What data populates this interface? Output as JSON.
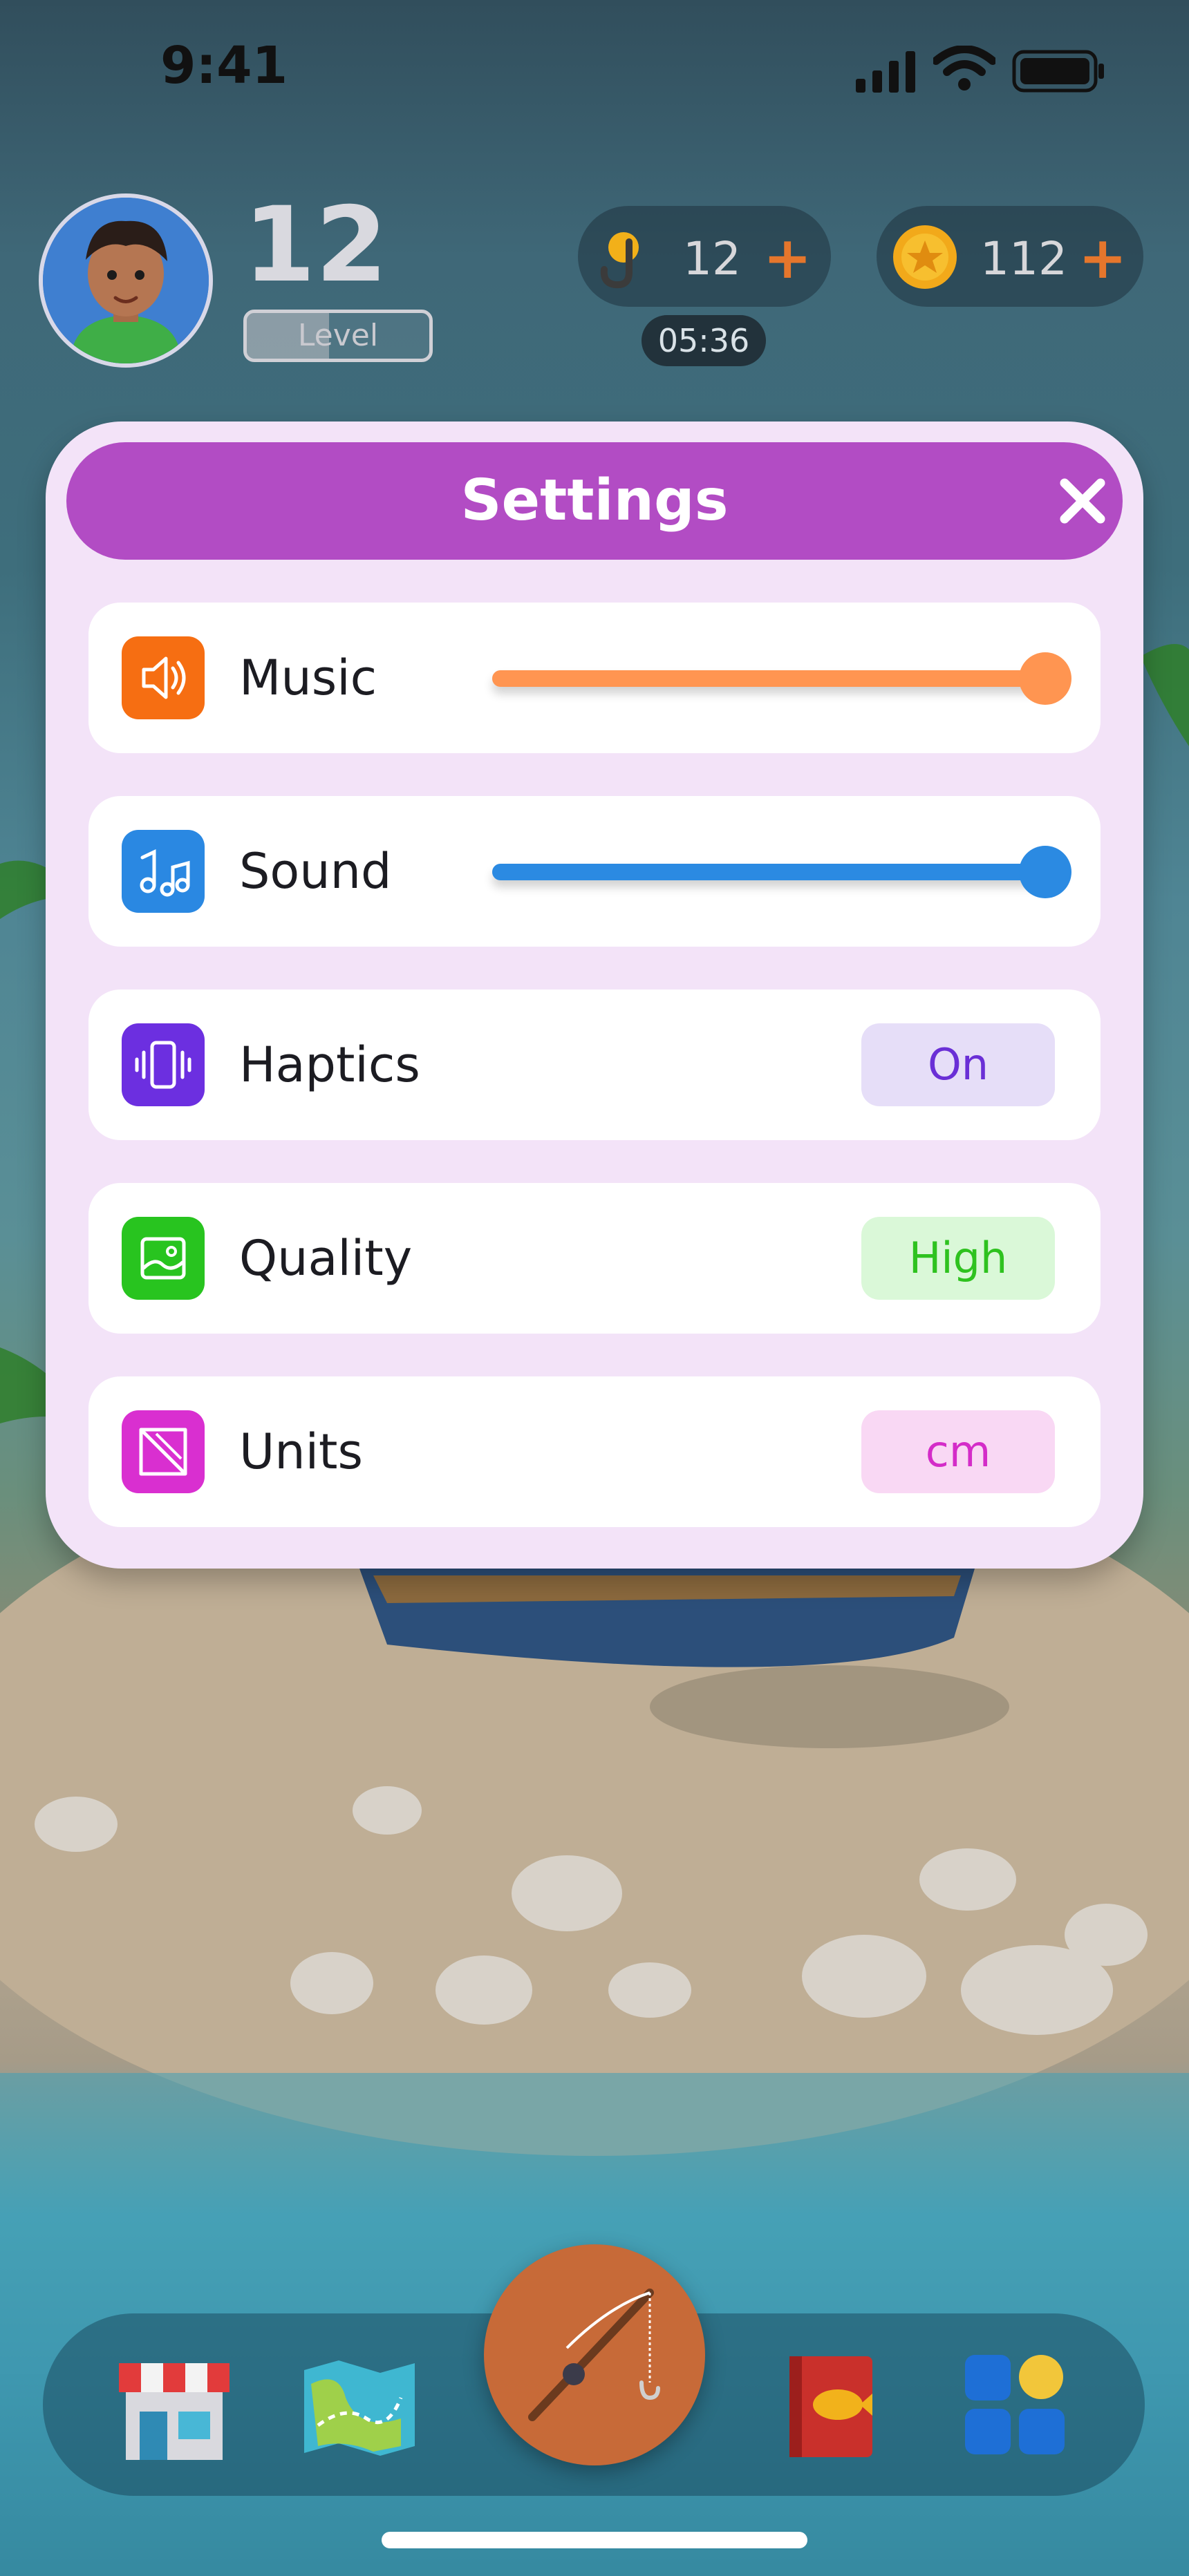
{
  "status_bar": {
    "time": "9:41"
  },
  "player": {
    "level": "12",
    "level_label": "Level",
    "level_progress": 0.45
  },
  "resources": {
    "bait": {
      "count": "12",
      "plus": "+",
      "timer": "05:36"
    },
    "coins": {
      "count": "112",
      "plus": "+"
    }
  },
  "settings": {
    "title": "Settings",
    "rows": [
      {
        "label": "Music",
        "type": "slider",
        "value": 1.0,
        "color": "#ff9551",
        "icon": "speaker-icon",
        "icon_bg": "#f66e12"
      },
      {
        "label": "Sound",
        "type": "slider",
        "value": 1.0,
        "color": "#2b8ae2",
        "icon": "music-notes-icon",
        "icon_bg": "#2a88e2"
      },
      {
        "label": "Haptics",
        "type": "toggle",
        "value": "On",
        "pill_bg": "#e6def8",
        "pill_fg": "#6a2fd6",
        "icon": "vibrate-icon",
        "icon_bg": "#6c2fe0"
      },
      {
        "label": "Quality",
        "type": "select",
        "value": "High",
        "pill_bg": "#daf8d8",
        "pill_fg": "#2ec21f",
        "icon": "image-icon",
        "icon_bg": "#28c41f"
      },
      {
        "label": "Units",
        "type": "select",
        "value": "cm",
        "pill_bg": "#f9d8f4",
        "pill_fg": "#d42cc8",
        "icon": "ruler-icon",
        "icon_bg": "#d92fd0"
      }
    ]
  },
  "dock": {
    "items": [
      {
        "name": "shop-icon"
      },
      {
        "name": "map-icon"
      },
      {
        "name": "fishing-rod-icon"
      },
      {
        "name": "fish-book-icon"
      },
      {
        "name": "more-apps-icon"
      }
    ]
  }
}
